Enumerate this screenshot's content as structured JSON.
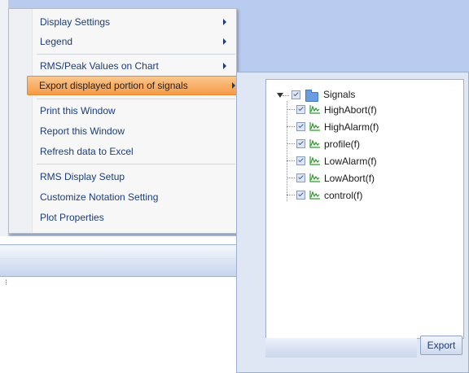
{
  "menu": {
    "items": [
      {
        "label": "Display Settings",
        "submenu": true
      },
      {
        "label": "Legend",
        "submenu": true
      },
      {
        "label": "RMS/Peak Values on Chart",
        "submenu": true
      },
      {
        "label": "Export displayed portion of signals",
        "submenu": true,
        "highlighted": true
      },
      {
        "label": "Print this Window",
        "submenu": false
      },
      {
        "label": "Report this Window",
        "submenu": false
      },
      {
        "label": "Refresh data to Excel",
        "submenu": false
      },
      {
        "label": "RMS Display Setup",
        "submenu": false
      },
      {
        "label": "Customize Notation Setting",
        "submenu": false
      },
      {
        "label": "Plot Properties",
        "submenu": false
      }
    ]
  },
  "export_panel": {
    "root_label": "Signals",
    "signals": [
      "HighAbort(f)",
      "HighAlarm(f)",
      "profile(f)",
      "LowAlarm(f)",
      "LowAbort(f)",
      "control(f)"
    ],
    "export_button": "Export"
  },
  "colors": {
    "highlight": "#f59a47",
    "background_blue": "#b9cbef",
    "signal_icon": "#2e9a2e"
  }
}
